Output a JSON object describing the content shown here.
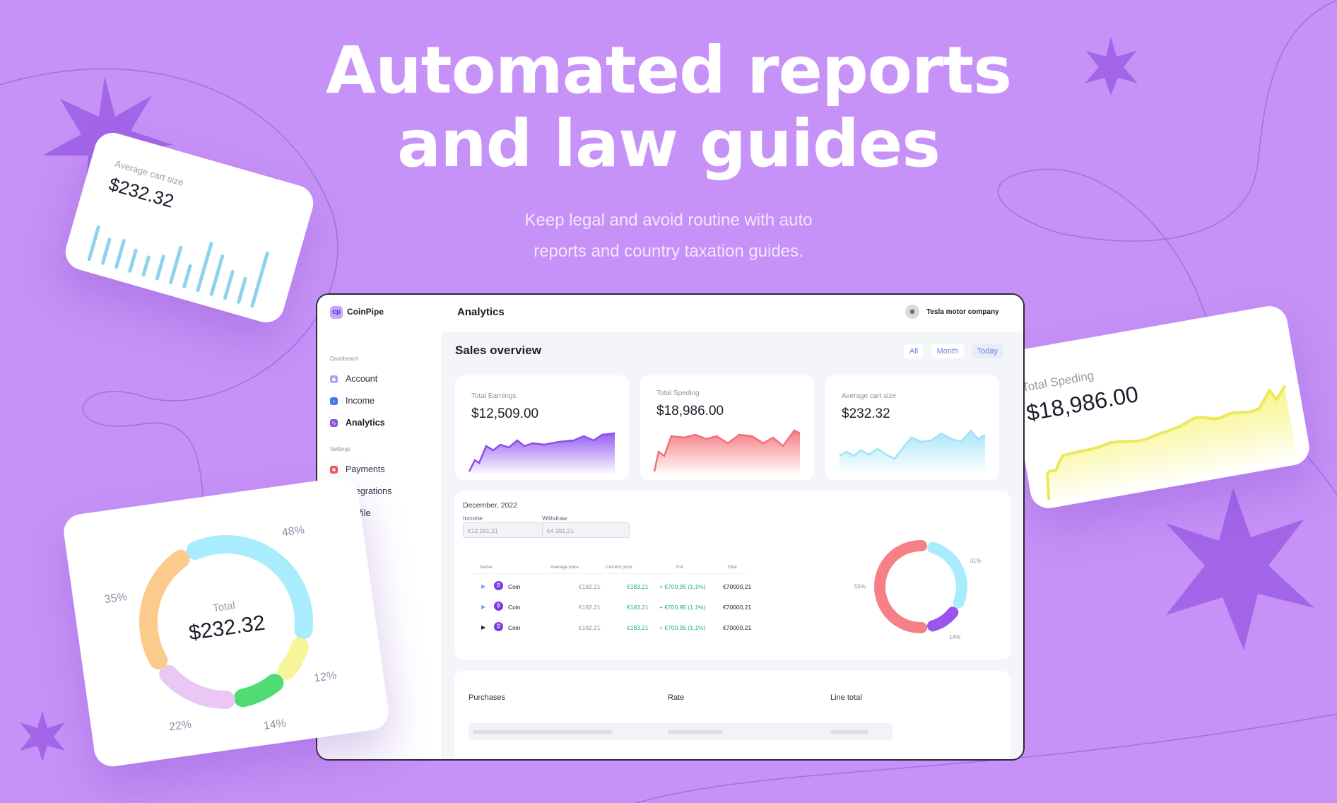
{
  "hero": {
    "title_line1": "Automated reports",
    "title_line2": "and law guides",
    "subtitle_line1": "Keep legal and avoid routine with auto",
    "subtitle_line2": "reports and country taxation guides."
  },
  "float_cart": {
    "label": "Average cart size",
    "value": "$232.32",
    "bars": [
      0.55,
      0.4,
      0.45,
      0.35,
      0.3,
      0.38,
      0.6,
      0.35,
      0.8,
      0.65,
      0.45,
      0.4,
      0.9
    ]
  },
  "float_spending": {
    "label": "Total Speding",
    "value": "$18,986.00"
  },
  "float_donut": {
    "center_label": "Total",
    "center_value": "$232.32",
    "segments": [
      {
        "label": "48%",
        "value": 48,
        "color": "#a8ecfd"
      },
      {
        "label": "12%",
        "value": 12,
        "color": "#f6f59a"
      },
      {
        "label": "14%",
        "value": 14,
        "color": "#4fdc72"
      },
      {
        "label": "22%",
        "value": 22,
        "color": "#eac7f4"
      },
      {
        "label": "35%",
        "value": 35,
        "color": "#fccb8c"
      }
    ]
  },
  "app": {
    "brand": "CoinPipe",
    "logo_glyph": "cp",
    "page_title": "Analytics",
    "company": "Tesla motor company",
    "sidebar": {
      "group1": "Dashboard",
      "group2": "Settings",
      "items": [
        {
          "label": "Account",
          "icon": "account-icon",
          "color": "#b89af6"
        },
        {
          "label": "Income",
          "icon": "income-icon",
          "color": "#4876ef"
        },
        {
          "label": "Analytics",
          "icon": "analytics-icon",
          "color": "#8b54e9"
        },
        {
          "label": "Payments",
          "icon": "payments-icon",
          "color": "#ef5a5a"
        },
        {
          "label": "Integrations",
          "icon": "integrations-icon",
          "color": "#2fbf62"
        },
        {
          "label": "Profile",
          "icon": "profile-icon",
          "color": "#ffffff"
        }
      ]
    },
    "sales_title": "Sales overview",
    "filters": [
      "All",
      "Month",
      "Today"
    ],
    "stats": [
      {
        "title": "Total Earnings",
        "value": "$12,509.00",
        "color": "#8a4ef0"
      },
      {
        "title": "Total Speding",
        "value": "$18,986.00",
        "color": "#f46f78"
      },
      {
        "title": "Average cart size",
        "value": "$232.32",
        "color": "#9fe3f8"
      }
    ],
    "panel": {
      "date": "December, 2022",
      "income_label": "Income",
      "income_value": "€12 291,21",
      "withdraw_label": "Withdraw",
      "withdraw_value": "€4 291,21",
      "columns": [
        "Name",
        "Average price",
        "Current price",
        "Pnl",
        "Total"
      ],
      "rows": [
        {
          "name": "Coin",
          "avg": "€182,21",
          "cur": "€183,21",
          "pnl": "+ €700,95 (1,1%)",
          "total": "€70000,21"
        },
        {
          "name": "Coin",
          "avg": "€182,21",
          "cur": "€183,21",
          "pnl": "+ €700,95 (1,1%)",
          "total": "€70000,21"
        },
        {
          "name": "Coin",
          "avg": "€182,21",
          "cur": "€183,21",
          "pnl": "+ €700,95 (1,1%)",
          "total": "€70000,21"
        }
      ],
      "donut": [
        {
          "label": "31%",
          "value": 31,
          "color": "#a8ecfd"
        },
        {
          "label": "14%",
          "value": 14,
          "color": "#9a55ef"
        },
        {
          "label": "55%",
          "value": 55,
          "color": "#f77f86"
        }
      ]
    },
    "purchases": {
      "col1": "Purchases",
      "col2": "Rate",
      "col3": "Line total"
    }
  }
}
